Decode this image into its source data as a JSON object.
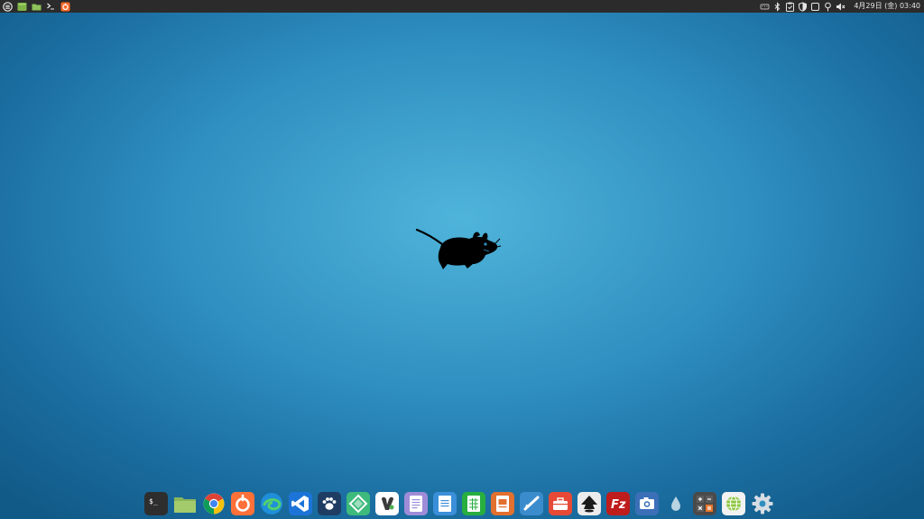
{
  "top_panel": {
    "left_launchers": [
      {
        "name": "applications-menu-icon"
      },
      {
        "name": "file-manager-icon"
      },
      {
        "name": "folder-icon"
      },
      {
        "name": "terminal-icon"
      },
      {
        "name": "firefox-icon"
      }
    ],
    "tray": [
      {
        "name": "keyboard-layout-icon"
      },
      {
        "name": "bluetooth-icon"
      },
      {
        "name": "clipboard-icon"
      },
      {
        "name": "security-shield-icon"
      },
      {
        "name": "notifications-icon"
      },
      {
        "name": "location-icon"
      },
      {
        "name": "volume-icon"
      }
    ],
    "clock": "4月29日 (金) 03:40"
  },
  "dock": {
    "items": [
      {
        "name": "terminal-icon",
        "color": "#2e2e2e"
      },
      {
        "name": "files-icon",
        "color": "#8ab55a"
      },
      {
        "name": "chrome-icon",
        "color": "#ffffff"
      },
      {
        "name": "firefox-icon",
        "color": "#ff7139"
      },
      {
        "name": "edge-icon",
        "color": "#1e8fd8"
      },
      {
        "name": "vscode-icon",
        "color": "#1d74d8"
      },
      {
        "name": "paw-app-icon",
        "color": "#1f3d63"
      },
      {
        "name": "android-studio-icon",
        "color": "#3dba7c"
      },
      {
        "name": "gimp-icon",
        "color": "#ffffff"
      },
      {
        "name": "text-editor-icon",
        "color": "#9e8cd8"
      },
      {
        "name": "writer-icon",
        "color": "#3b8fd9"
      },
      {
        "name": "calc-icon",
        "color": "#27ae3f"
      },
      {
        "name": "impress-icon",
        "color": "#e2702f"
      },
      {
        "name": "draw-icon",
        "color": "#3a8ccd"
      },
      {
        "name": "toolbox-icon",
        "color": "#e64a37"
      },
      {
        "name": "inkscape-icon",
        "color": "#ececec"
      },
      {
        "name": "filezilla-icon",
        "color": "#bf1c1c"
      },
      {
        "name": "screenshot-icon",
        "color": "#3b6fb8"
      },
      {
        "name": "color-picker-icon",
        "color": "#b9d4e2"
      },
      {
        "name": "calculator-icon",
        "color": "#4a4a4a"
      },
      {
        "name": "web-browser-icon",
        "color": "#8cc63f"
      },
      {
        "name": "settings-icon",
        "color": "#d6dde3"
      }
    ]
  }
}
